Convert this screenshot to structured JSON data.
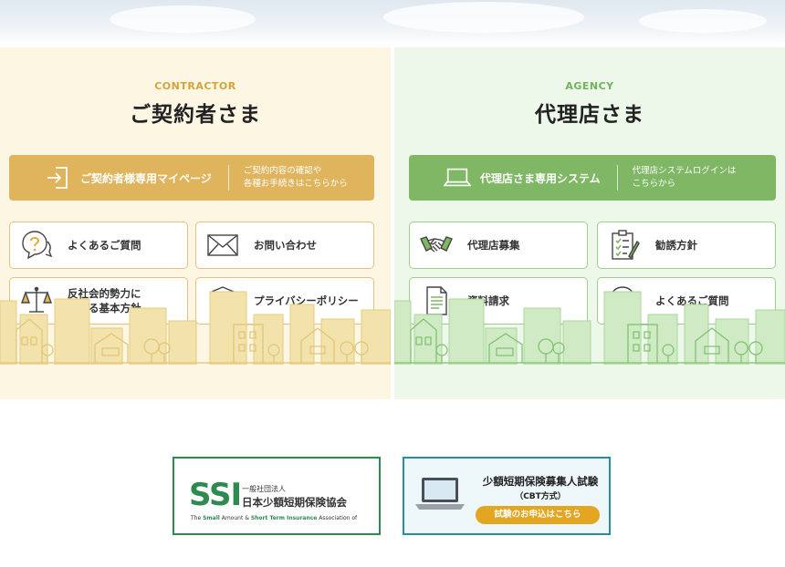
{
  "contractor": {
    "eyebrow": "CONTRACTOR",
    "title": "ご契約者さま",
    "main_button": {
      "label": "ご契約者様専用マイページ",
      "desc": "ご契約内容の確認や\n各種お手続きはこちらから",
      "icon": "login-icon"
    },
    "links": [
      {
        "label": "よくあるご質問",
        "icon": "faq-question-icon"
      },
      {
        "label": "お問い合わせ",
        "icon": "mail-envelope-icon"
      },
      {
        "label": "反社会的勢力に\n対する基本方針",
        "icon": "scales-icon"
      },
      {
        "label": "プライバシーポリシー",
        "icon": "shield-check-icon"
      }
    ]
  },
  "agency": {
    "eyebrow": "AGENCY",
    "title": "代理店さま",
    "main_button": {
      "label": "代理店さま専用システム",
      "desc": "代理店システムログインは\nこちらから",
      "icon": "laptop-icon"
    },
    "links": [
      {
        "label": "代理店募集",
        "icon": "handshake-icon"
      },
      {
        "label": "勧誘方針",
        "icon": "checklist-icon"
      },
      {
        "label": "資料請求",
        "icon": "document-icon"
      },
      {
        "label": "よくあるご質問",
        "icon": "faq-question-icon"
      }
    ]
  },
  "banners": {
    "ssi": {
      "logo": "SSI",
      "small": "一般社団法人",
      "name": "日本少額短期保険協会",
      "en_prefix": "The ",
      "en_small": "Small",
      "en_mid1": " Amount & ",
      "en_short": "Short Term Insurance",
      "en_suffix": " Association of"
    },
    "cbt": {
      "title": "少額短期保険募集人試験",
      "subtitle": "（CBT方式）",
      "button": "試験のお申込はこちら"
    }
  },
  "colors": {
    "contractor_accent": "#e0b45d",
    "agency_accent": "#7fb764",
    "contractor_bg": "#fdf6e3",
    "agency_bg": "#edf7ea"
  }
}
